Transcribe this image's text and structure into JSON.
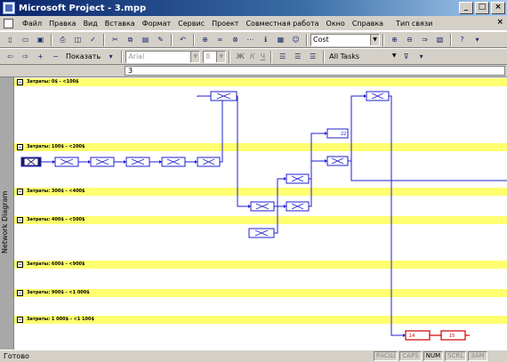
{
  "window": {
    "title": "Microsoft Project - 3.mpp"
  },
  "menu": {
    "items": [
      "Файл",
      "Правка",
      "Вид",
      "Вставка",
      "Формат",
      "Сервис",
      "Проект",
      "Совместная работа",
      "Окно",
      "Справка"
    ],
    "help_field": "Тип связи"
  },
  "toolbar": {
    "cost_combo": "Cost",
    "show_label": "Показать",
    "font_combo": "Arial",
    "size_combo": "8",
    "bold": "Ж",
    "italic": "К",
    "underline": "Ч",
    "filter_combo": "All Tasks"
  },
  "entry_bar": {
    "value": "3"
  },
  "side_label": "Network Diagram",
  "bands": [
    "Затраты: 0$ - <100$",
    "Затраты: 100$ - <200$",
    "Затраты: 300$ - <400$",
    "Затраты: 400$ - <500$",
    "Затраты: 600$ - <900$",
    "Затраты: 900$ - <1 000$",
    "Затраты: 1 000$ - <1 100$"
  ],
  "nodes": {
    "n22": "22",
    "n14": "14",
    "n15": "15"
  },
  "status": {
    "text": "Готово",
    "indicators": [
      "РАСШ",
      "CAPS",
      "NUM",
      "SCRL",
      "ЗАМ"
    ]
  },
  "colors": {
    "band": "#ffff6f",
    "link": "#1f1fcc",
    "critical": "#cc0000",
    "titlebar": "#0a246a"
  }
}
